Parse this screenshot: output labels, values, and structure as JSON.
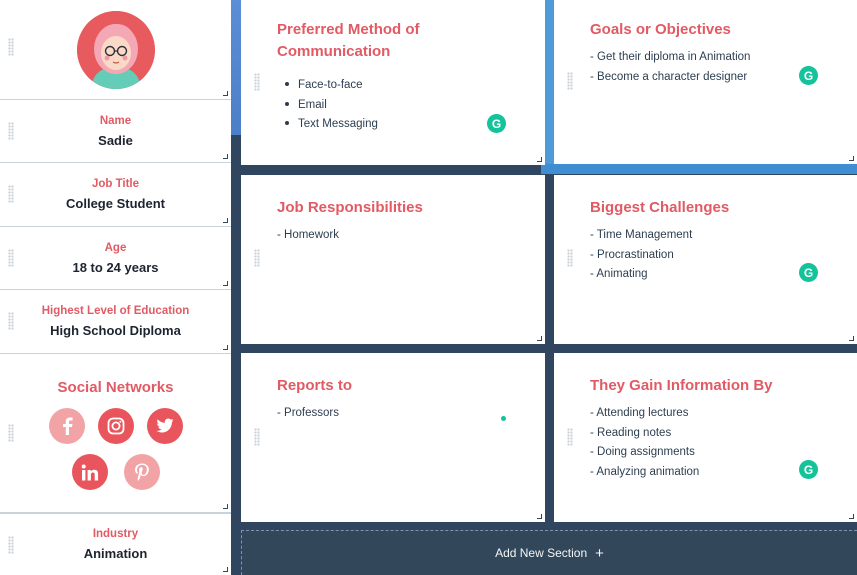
{
  "profile": {
    "name_label": "Name",
    "name_value": "Sadie",
    "job_label": "Job Title",
    "job_value": "College Student",
    "age_label": "Age",
    "age_value": "18 to 24 years",
    "education_label": "Highest Level of Education",
    "education_value": "High School Diploma",
    "social_title": "Social Networks",
    "social_icons": [
      "facebook-icon",
      "instagram-icon",
      "twitter-icon",
      "linkedin-icon",
      "pinterest-icon"
    ],
    "industry_label": "Industry",
    "industry_value": "Animation"
  },
  "panels": {
    "communication": {
      "title_line1": "Preferred Method of",
      "title_line2": "Communication",
      "items": [
        "Face-to-face",
        "Email",
        "Text Messaging"
      ]
    },
    "goals": {
      "title": "Goals or Objectives",
      "items": [
        "- Get their diploma in Animation",
        "- Become a character designer"
      ]
    },
    "responsibilities": {
      "title": "Job Responsibilities",
      "items": [
        "- Homework"
      ]
    },
    "challenges": {
      "title": "Biggest Challenges",
      "items": [
        "- Time Management",
        "- Procrastination",
        "- Animating"
      ]
    },
    "reports": {
      "title": "Reports to",
      "items": [
        "- Professors"
      ]
    },
    "information": {
      "title": "They Gain Information By",
      "items": [
        "- Attending lectures",
        "- Reading notes",
        "- Doing assignments",
        "- Analyzing animation"
      ]
    }
  },
  "add_section": {
    "label": "Add New Section",
    "icon": "plus-icon"
  },
  "colors": {
    "accent": "#e15a64",
    "text": "#2d3e50",
    "background": "#2f4560",
    "grammarly": "#15c39a",
    "social_strong": "#e8555c",
    "social_dim": "#f2a3a6"
  },
  "grammarly_badge": "G"
}
